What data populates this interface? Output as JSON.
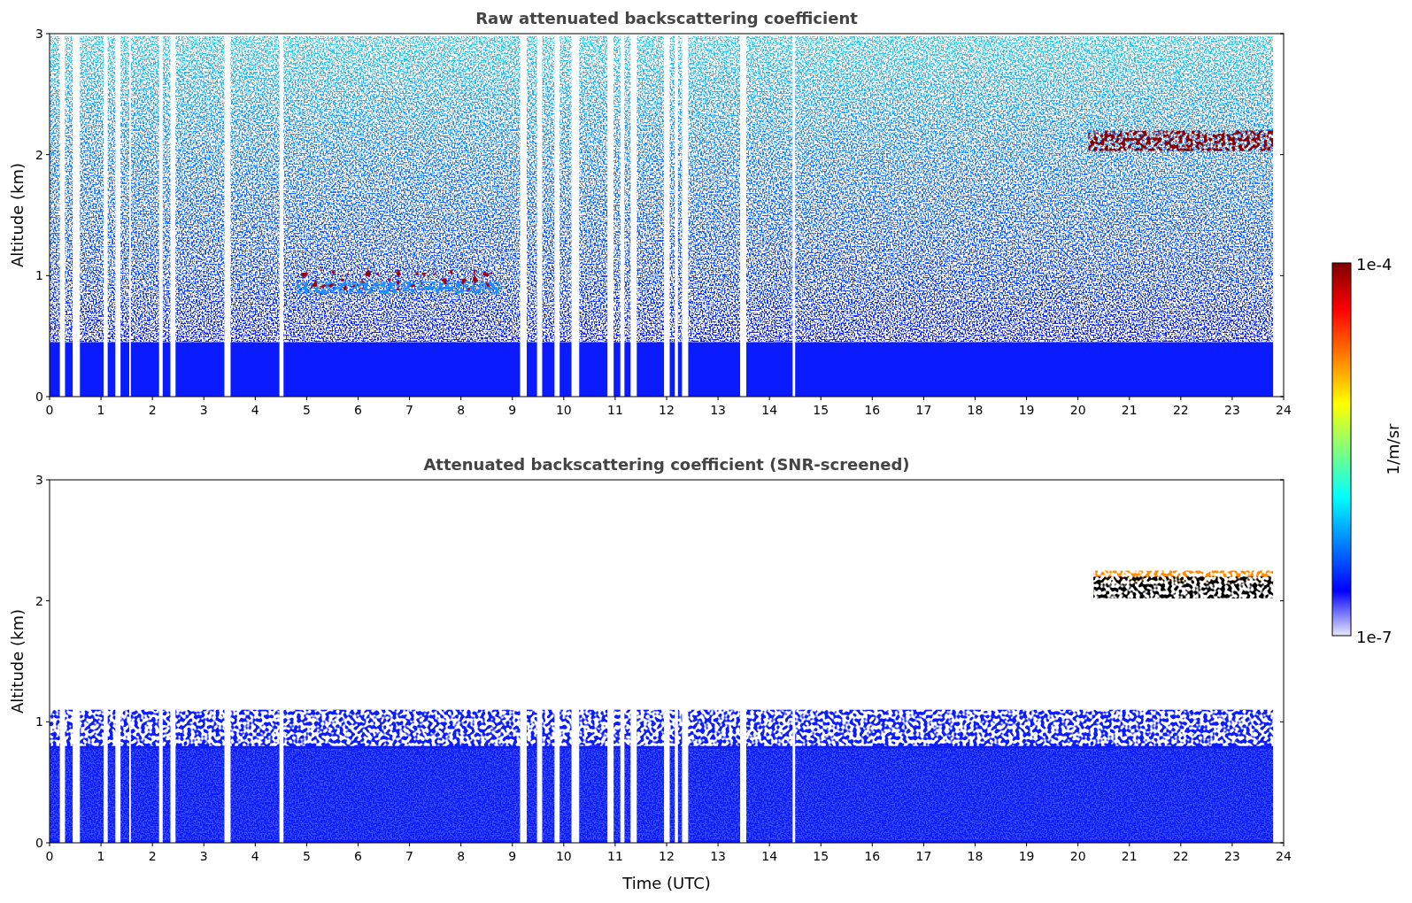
{
  "plots": [
    {
      "kind": "raw",
      "title": "Raw attenuated backscattering coefficient",
      "ylabel": "Altitude (km)",
      "xticks": [
        "0",
        "1",
        "2",
        "3",
        "4",
        "5",
        "6",
        "7",
        "8",
        "9",
        "10",
        "11",
        "12",
        "13",
        "14",
        "15",
        "16",
        "17",
        "18",
        "19",
        "20",
        "21",
        "22",
        "23",
        "24"
      ],
      "yticks": [
        "3",
        "2",
        "1",
        "0"
      ]
    },
    {
      "kind": "screened",
      "title": "Attenuated backscattering coefficient (SNR-screened)",
      "ylabel": "Altitude (km)",
      "xticks": [
        "0",
        "1",
        "2",
        "3",
        "4",
        "5",
        "6",
        "7",
        "8",
        "9",
        "10",
        "11",
        "12",
        "13",
        "14",
        "15",
        "16",
        "17",
        "18",
        "19",
        "20",
        "21",
        "22",
        "23",
        "24"
      ],
      "yticks": [
        "3",
        "2",
        "1",
        "0"
      ]
    }
  ],
  "xlabel": "Time (UTC)",
  "colorbar": {
    "label": "1/m/sr",
    "max_label": "1e-4",
    "min_label": "1e-7"
  }
}
